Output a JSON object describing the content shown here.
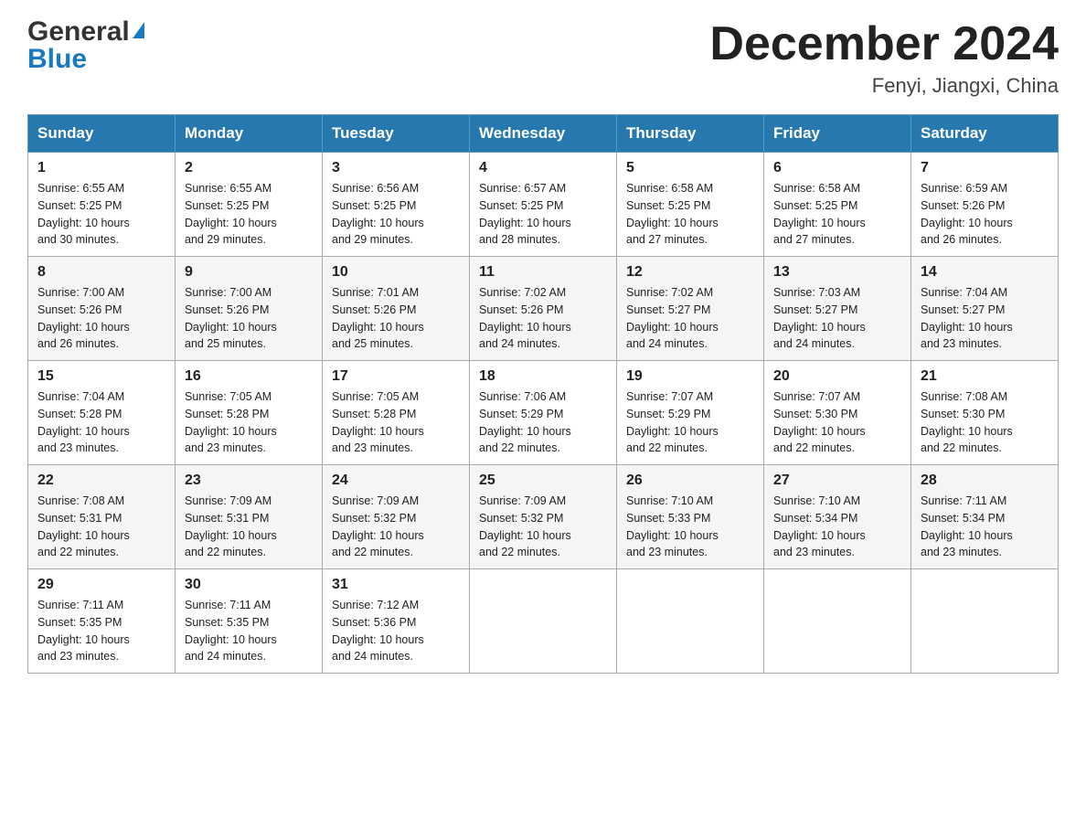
{
  "header": {
    "logo_general": "General",
    "logo_blue": "Blue",
    "month_title": "December 2024",
    "location": "Fenyi, Jiangxi, China"
  },
  "calendar": {
    "days_of_week": [
      "Sunday",
      "Monday",
      "Tuesday",
      "Wednesday",
      "Thursday",
      "Friday",
      "Saturday"
    ],
    "weeks": [
      [
        {
          "day": "1",
          "sunrise": "6:55 AM",
          "sunset": "5:25 PM",
          "daylight": "10 hours and 30 minutes."
        },
        {
          "day": "2",
          "sunrise": "6:55 AM",
          "sunset": "5:25 PM",
          "daylight": "10 hours and 29 minutes."
        },
        {
          "day": "3",
          "sunrise": "6:56 AM",
          "sunset": "5:25 PM",
          "daylight": "10 hours and 29 minutes."
        },
        {
          "day": "4",
          "sunrise": "6:57 AM",
          "sunset": "5:25 PM",
          "daylight": "10 hours and 28 minutes."
        },
        {
          "day": "5",
          "sunrise": "6:58 AM",
          "sunset": "5:25 PM",
          "daylight": "10 hours and 27 minutes."
        },
        {
          "day": "6",
          "sunrise": "6:58 AM",
          "sunset": "5:25 PM",
          "daylight": "10 hours and 27 minutes."
        },
        {
          "day": "7",
          "sunrise": "6:59 AM",
          "sunset": "5:26 PM",
          "daylight": "10 hours and 26 minutes."
        }
      ],
      [
        {
          "day": "8",
          "sunrise": "7:00 AM",
          "sunset": "5:26 PM",
          "daylight": "10 hours and 26 minutes."
        },
        {
          "day": "9",
          "sunrise": "7:00 AM",
          "sunset": "5:26 PM",
          "daylight": "10 hours and 25 minutes."
        },
        {
          "day": "10",
          "sunrise": "7:01 AM",
          "sunset": "5:26 PM",
          "daylight": "10 hours and 25 minutes."
        },
        {
          "day": "11",
          "sunrise": "7:02 AM",
          "sunset": "5:26 PM",
          "daylight": "10 hours and 24 minutes."
        },
        {
          "day": "12",
          "sunrise": "7:02 AM",
          "sunset": "5:27 PM",
          "daylight": "10 hours and 24 minutes."
        },
        {
          "day": "13",
          "sunrise": "7:03 AM",
          "sunset": "5:27 PM",
          "daylight": "10 hours and 24 minutes."
        },
        {
          "day": "14",
          "sunrise": "7:04 AM",
          "sunset": "5:27 PM",
          "daylight": "10 hours and 23 minutes."
        }
      ],
      [
        {
          "day": "15",
          "sunrise": "7:04 AM",
          "sunset": "5:28 PM",
          "daylight": "10 hours and 23 minutes."
        },
        {
          "day": "16",
          "sunrise": "7:05 AM",
          "sunset": "5:28 PM",
          "daylight": "10 hours and 23 minutes."
        },
        {
          "day": "17",
          "sunrise": "7:05 AM",
          "sunset": "5:28 PM",
          "daylight": "10 hours and 23 minutes."
        },
        {
          "day": "18",
          "sunrise": "7:06 AM",
          "sunset": "5:29 PM",
          "daylight": "10 hours and 22 minutes."
        },
        {
          "day": "19",
          "sunrise": "7:07 AM",
          "sunset": "5:29 PM",
          "daylight": "10 hours and 22 minutes."
        },
        {
          "day": "20",
          "sunrise": "7:07 AM",
          "sunset": "5:30 PM",
          "daylight": "10 hours and 22 minutes."
        },
        {
          "day": "21",
          "sunrise": "7:08 AM",
          "sunset": "5:30 PM",
          "daylight": "10 hours and 22 minutes."
        }
      ],
      [
        {
          "day": "22",
          "sunrise": "7:08 AM",
          "sunset": "5:31 PM",
          "daylight": "10 hours and 22 minutes."
        },
        {
          "day": "23",
          "sunrise": "7:09 AM",
          "sunset": "5:31 PM",
          "daylight": "10 hours and 22 minutes."
        },
        {
          "day": "24",
          "sunrise": "7:09 AM",
          "sunset": "5:32 PM",
          "daylight": "10 hours and 22 minutes."
        },
        {
          "day": "25",
          "sunrise": "7:09 AM",
          "sunset": "5:32 PM",
          "daylight": "10 hours and 22 minutes."
        },
        {
          "day": "26",
          "sunrise": "7:10 AM",
          "sunset": "5:33 PM",
          "daylight": "10 hours and 23 minutes."
        },
        {
          "day": "27",
          "sunrise": "7:10 AM",
          "sunset": "5:34 PM",
          "daylight": "10 hours and 23 minutes."
        },
        {
          "day": "28",
          "sunrise": "7:11 AM",
          "sunset": "5:34 PM",
          "daylight": "10 hours and 23 minutes."
        }
      ],
      [
        {
          "day": "29",
          "sunrise": "7:11 AM",
          "sunset": "5:35 PM",
          "daylight": "10 hours and 23 minutes."
        },
        {
          "day": "30",
          "sunrise": "7:11 AM",
          "sunset": "5:35 PM",
          "daylight": "10 hours and 24 minutes."
        },
        {
          "day": "31",
          "sunrise": "7:12 AM",
          "sunset": "5:36 PM",
          "daylight": "10 hours and 24 minutes."
        },
        null,
        null,
        null,
        null
      ]
    ],
    "sunrise_label": "Sunrise:",
    "sunset_label": "Sunset:",
    "daylight_label": "Daylight:"
  }
}
